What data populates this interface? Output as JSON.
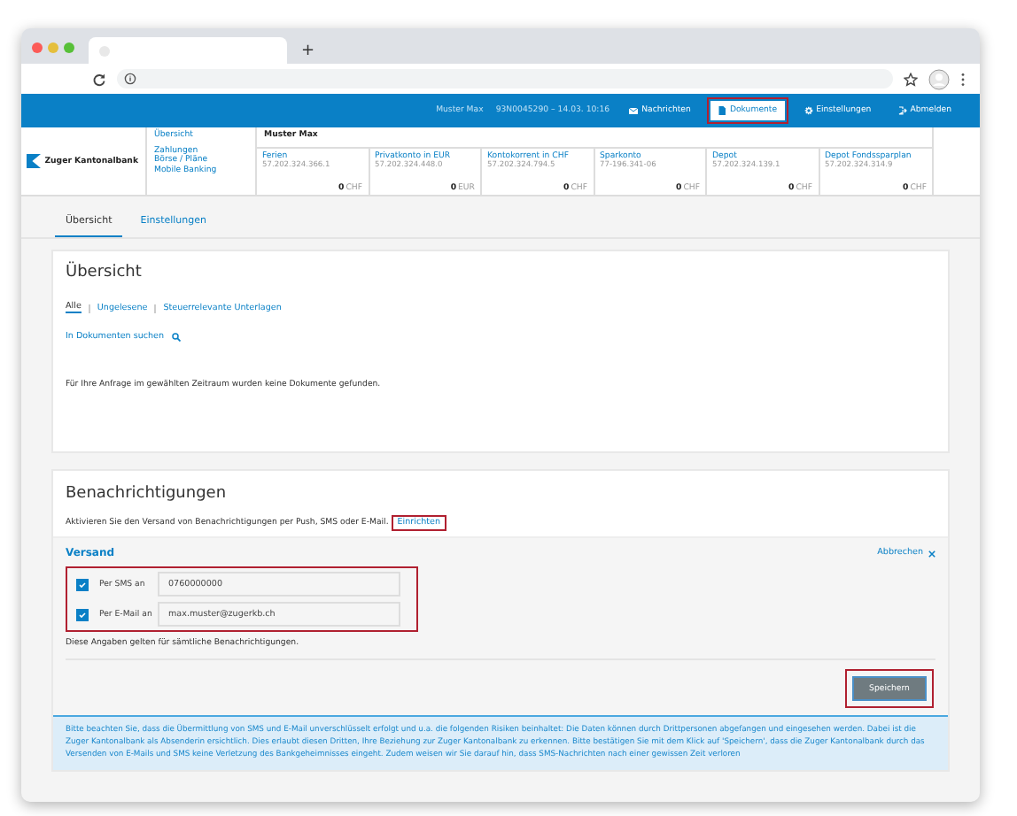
{
  "browser": {
    "new_tab": "+"
  },
  "header": {
    "user": "Muster Max",
    "session": "93N0045290 – 14.03. 10:16",
    "actions": [
      {
        "kind": "messages",
        "label": "Nachrichten",
        "selected": false
      },
      {
        "kind": "documents",
        "label": "Dokumente",
        "selected": true
      },
      {
        "kind": "settings",
        "label": "Einstellungen",
        "selected": false
      },
      {
        "kind": "logout",
        "label": "Abmelden",
        "selected": false
      }
    ]
  },
  "bank": {
    "name": "Zuger Kantonalbank"
  },
  "nav": [
    "Übersicht",
    "Zahlungen",
    "Börse / Pläne",
    "Mobile Banking"
  ],
  "accounts": {
    "owner": "Muster Max",
    "items": [
      {
        "name": "Ferien",
        "number": "57.202.324.366.1",
        "amount": "0",
        "currency": "CHF"
      },
      {
        "name": "Privatkonto in EUR",
        "number": "57.202.324.448.0",
        "amount": "0",
        "currency": "EUR"
      },
      {
        "name": "Kontokorrent in CHF",
        "number": "57.202.324.794.5",
        "amount": "0",
        "currency": "CHF"
      },
      {
        "name": "Sparkonto",
        "number": "77-196.341-06",
        "amount": "0",
        "currency": "CHF"
      },
      {
        "name": "Depot",
        "number": "57.202.324.139.1",
        "amount": "0",
        "currency": "CHF"
      },
      {
        "name": "Depot Fondssparplan",
        "number": "57.202.324.314.9",
        "amount": "0",
        "currency": "CHF"
      }
    ]
  },
  "tabs": [
    {
      "label": "Übersicht",
      "selected": true
    },
    {
      "label": "Einstellungen",
      "selected": false
    }
  ],
  "overview": {
    "title": "Übersicht",
    "filters": [
      {
        "label": "Alle",
        "selected": true
      },
      {
        "label": "Ungelesene",
        "selected": false
      },
      {
        "label": "Steuerrelevante Unterlagen",
        "selected": false
      }
    ],
    "search_link": "In Dokumenten suchen",
    "empty_message": "Für Ihre Anfrage im gewählten Zeitraum wurden keine Dokumente gefunden."
  },
  "notifications": {
    "title": "Benachrichtigungen",
    "intro": "Aktivieren Sie den Versand von Benachrichtigungen per Push, SMS oder E-Mail.",
    "setup_link": "Einrichten",
    "panel": {
      "title": "Versand",
      "cancel": "Abbrechen",
      "channels": [
        {
          "label": "Per SMS an",
          "checked": true,
          "value": "0760000000"
        },
        {
          "label": "Per E-Mail an",
          "checked": true,
          "value": "max.muster@zugerkb.ch"
        }
      ],
      "note": "Diese Angaben gelten für sämtliche Benachrichtigungen.",
      "save": "Speichern"
    },
    "notice": "Bitte beachten Sie, dass die Übermittlung von SMS und E-Mail unverschlüsselt erfolgt und u.a. die folgenden Risiken beinhaltet: Die Daten können durch Drittpersonen abgefangen und eingesehen werden. Dabei ist die Zuger Kantonalbank als Absenderin ersichtlich. Dies erlaubt diesen Dritten, Ihre Beziehung zur Zuger Kantonalbank zu erkennen. Bitte bestätigen Sie mit dem Klick auf 'Speichern', dass die Zuger Kantonalbank durch das Versenden von E-Mails und SMS keine Verletzung des Bankgeheimnisses eingeht. Zudem weisen wir Sie darauf hin, dass SMS-Nachrichten nach einer gewissen Zeit verloren"
  }
}
